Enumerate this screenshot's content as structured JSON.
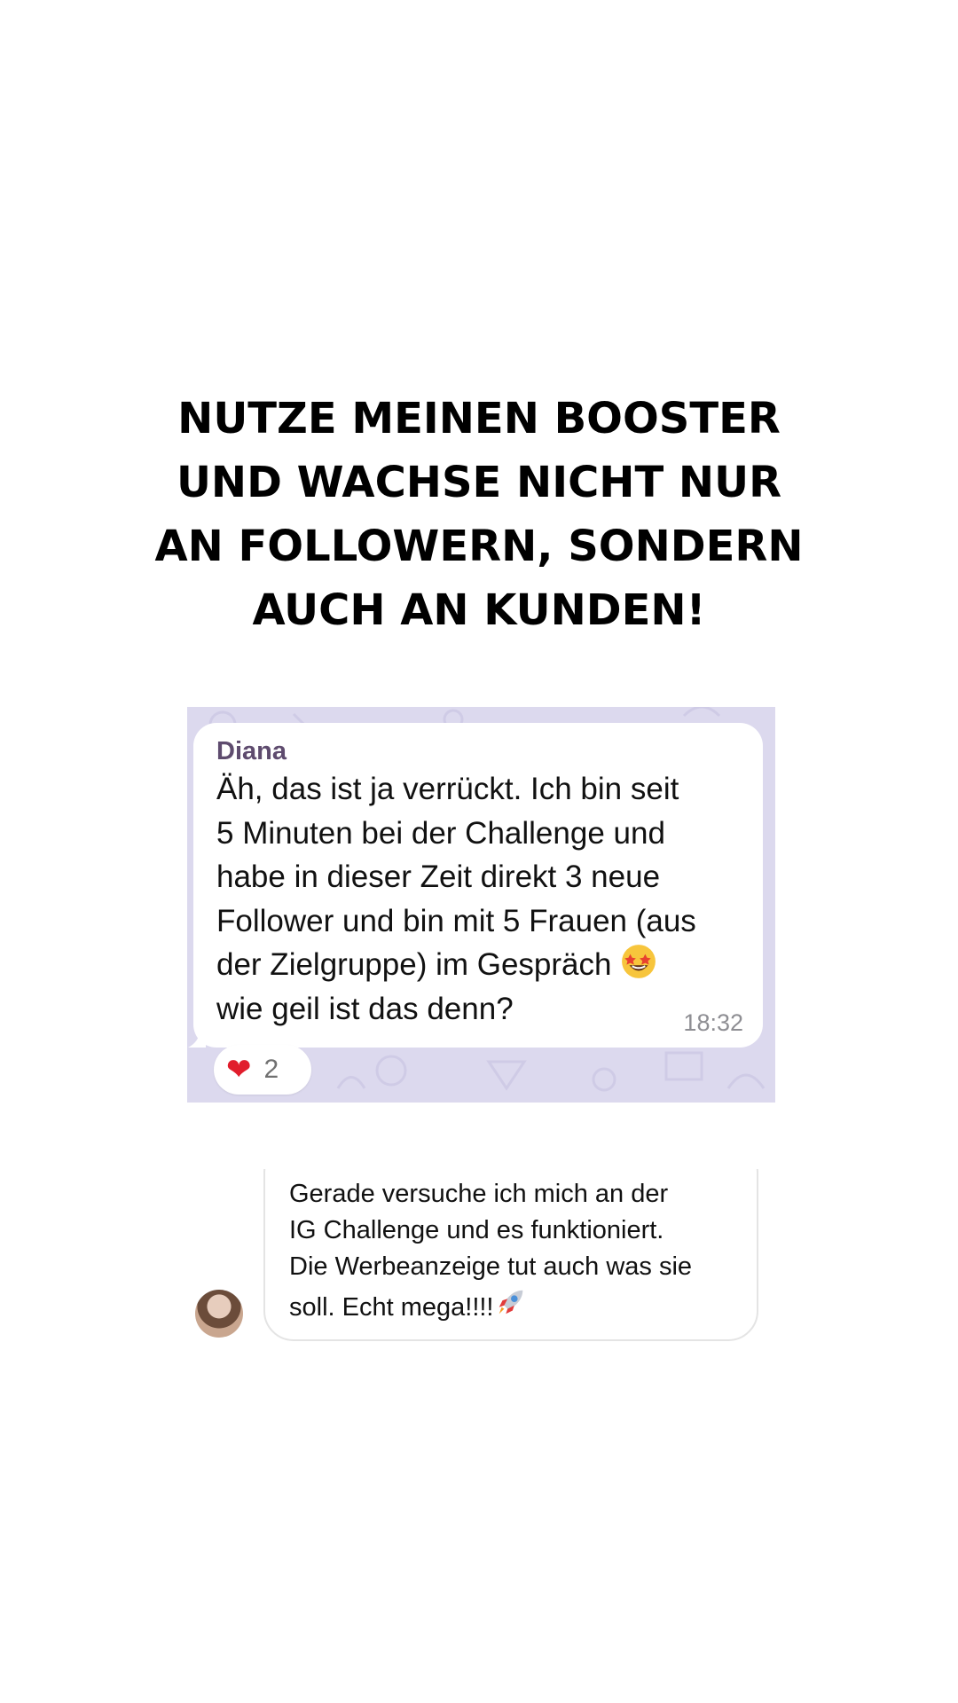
{
  "headline": {
    "line1": "NUTZE MEINEN BOOSTER",
    "line2": "UND WACHSE NICHT NUR",
    "line3": "AN FOLLOWERN, SONDERN",
    "line4": "AUCH AN KUNDEN!"
  },
  "testimonial1": {
    "sender": "Diana",
    "message": "Äh, das ist ja verrückt. Ich bin seit\n5 Minuten bei der Challenge und\nhabe in dieser Zeit direkt 3 neue\nFollower und bin mit 5 Frauen (aus\nder Zielgruppe) im Gespräch ",
    "message_end": "\nwie geil ist das denn?",
    "emoji": "star-struck-emoji",
    "time": "18:32",
    "reaction": {
      "icon": "heart-icon",
      "count": "2"
    },
    "colors": {
      "background": "#dcd9ee",
      "sender": "#5e4b6e"
    }
  },
  "testimonial2": {
    "message": "Gerade versuche ich mich an der\nIG Challenge und es funktioniert.\nDie Werbeanzeige tut auch was sie\nsoll. Echt mega!!!!",
    "emoji": "rocket-emoji"
  }
}
